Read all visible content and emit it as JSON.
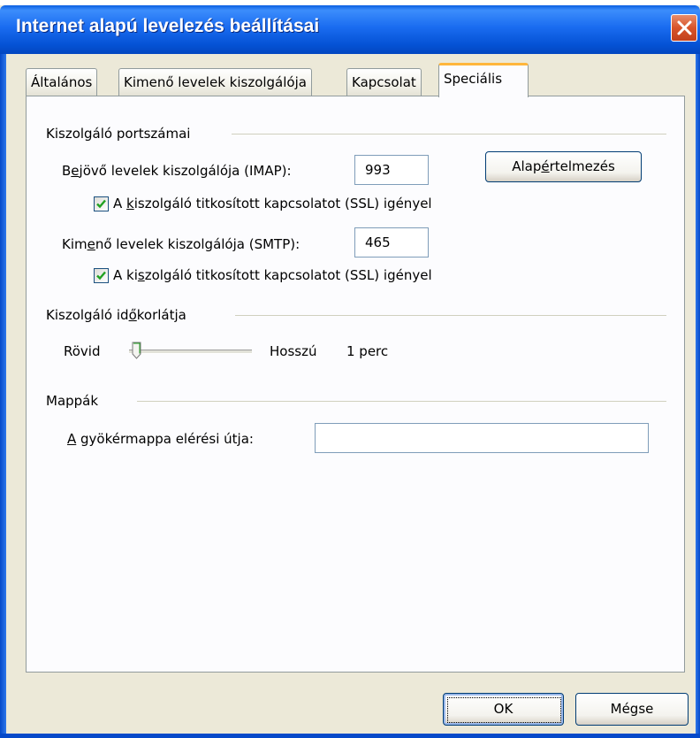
{
  "window": {
    "title": "Internet alapú levelezés beállításai"
  },
  "tabs": [
    {
      "label": "Általános",
      "active": false
    },
    {
      "label": "Kimenő levelek kiszolgálója",
      "active": false
    },
    {
      "label": "Kapcsolat",
      "active": false
    },
    {
      "label": "Speciális",
      "active": true
    }
  ],
  "ports": {
    "group_label": "Kiszolgáló portszámai",
    "incoming": {
      "label_prefix": "B",
      "label_mnemonic": "e",
      "label_rest": "jövő levelek kiszolgálója (IMAP):",
      "value": "993"
    },
    "incoming_ssl": {
      "checked": true,
      "label_prefix": "A ",
      "label_mnemonic": "k",
      "label_rest": "iszolgáló titkosított kapcsolatot (SSL) igényel"
    },
    "outgoing": {
      "label_prefix": "Kim",
      "label_mnemonic": "e",
      "label_rest": "nő levelek kiszolgálója (SMTP):",
      "value": "465"
    },
    "outgoing_ssl": {
      "checked": true,
      "label_prefix": "A ki",
      "label_mnemonic": "s",
      "label_rest": "zolgáló titkosított kapcsolatot (SSL) igényel"
    },
    "defaults_button": {
      "label_prefix": "Alap",
      "label_mnemonic": "é",
      "label_rest": "rtelmezés"
    }
  },
  "timeout": {
    "group_label_prefix": "Kiszolgáló id",
    "group_label_mnemonic": "ő",
    "group_label_rest": "korlátja",
    "min_label": "Rövid",
    "max_label": "Hosszú",
    "value_text": "1 perc",
    "slider_fraction": 0.0
  },
  "folders": {
    "group_label": "Mappák",
    "root_label_mnemonic": "A",
    "root_label_rest": " gyökérmappa elérési útja:",
    "root_value": ""
  },
  "buttons": {
    "ok": "OK",
    "cancel": "Mégse"
  },
  "icons": {
    "close": "close-icon",
    "checkmark": "checkmark-icon",
    "slider_thumb": "slider-thumb-icon"
  },
  "colors": {
    "titlebar": "#0a5fe0",
    "dialog_bg": "#ece9d8",
    "active_tab_accent": "#ffb63c",
    "checkmark": "#21a121",
    "close_button": "#d8542a"
  }
}
